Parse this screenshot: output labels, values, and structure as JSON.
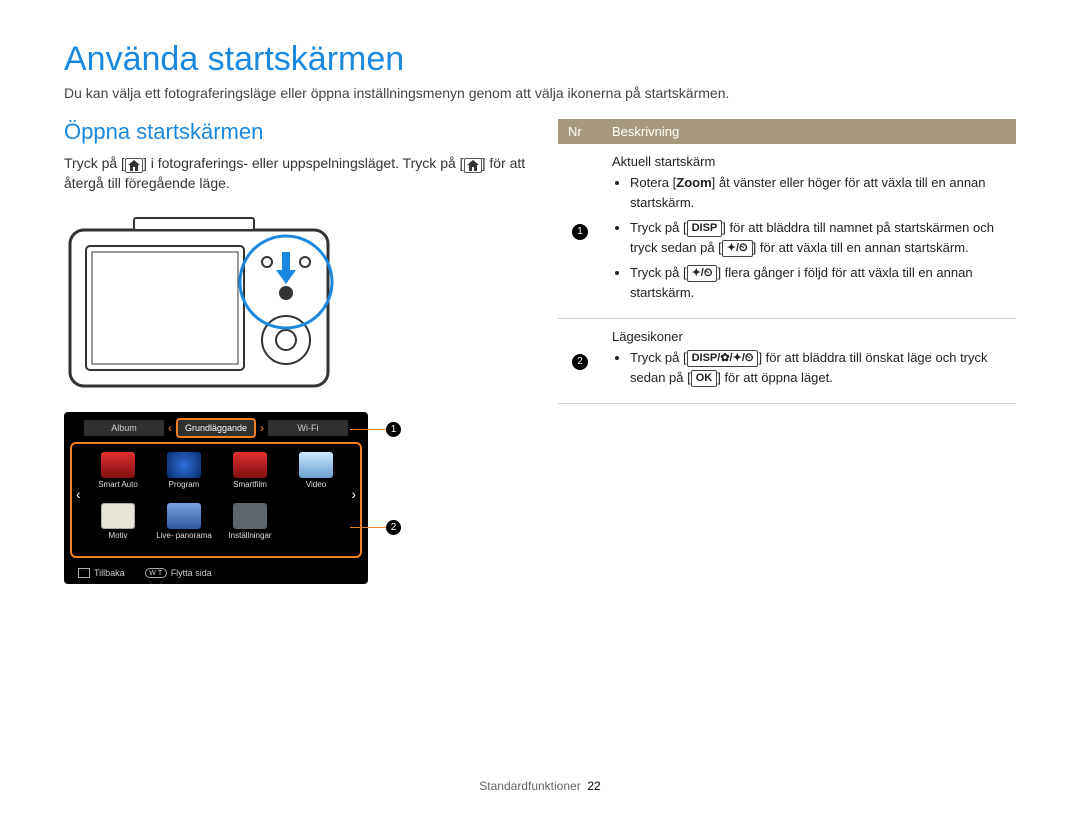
{
  "title": "Använda startskärmen",
  "intro": "Du kan välja ett fotograferingsläge eller öppna inställningsmenyn genom att välja ikonerna på startskärmen.",
  "subtitle": "Öppna startskärmen",
  "para_before_home1": "Tryck på [",
  "para_mid": "] i fotograferings- eller uppspelningsläget. Tryck på [",
  "para_after_home2": "] för att återgå till föregående läge.",
  "tabs": {
    "left": "Album",
    "center": "Grundläggande",
    "right": "Wi-Fi"
  },
  "modes": [
    {
      "key": "smartauto",
      "label": "Smart Auto"
    },
    {
      "key": "program",
      "label": "Program"
    },
    {
      "key": "smartfilm",
      "label": "Smartfilm"
    },
    {
      "key": "video",
      "label": "Video"
    },
    {
      "key": "motiv",
      "label": "Motiv"
    },
    {
      "key": "livepan",
      "label": "Live-\npanorama"
    },
    {
      "key": "settings",
      "label": "Inställningar"
    }
  ],
  "footerbar": {
    "back": "Tillbaka",
    "move": "Flytta sida"
  },
  "table": {
    "head": {
      "nr": "Nr",
      "desc": "Beskrivning"
    },
    "row1": {
      "lead": "Aktuell startskärm",
      "b1_a": "Rotera [",
      "b1_zoom": "Zoom",
      "b1_b": "] åt vänster eller höger för att växla till en annan startskärm.",
      "b2_a": "Tryck på [",
      "b2_disp": "DISP",
      "b2_b": "] för att bläddra till namnet på startskärmen och tryck sedan på [",
      "b2_c": "] för att växla till en annan startskärm.",
      "b3_a": "Tryck på [",
      "b3_b": "] flera gånger i följd för att växla till en annan startskärm."
    },
    "row2": {
      "lead": "Lägesikoner",
      "b1_a": "Tryck på [",
      "b1_disp": "DISP",
      "b1_b": "] för att bläddra till önskat läge och tryck sedan på [",
      "b1_ok": "OK",
      "b1_c": "] för att öppna läget."
    }
  },
  "callouts": {
    "c1": "1",
    "c2": "2"
  },
  "footer": {
    "section": "Standardfunktioner",
    "page": "22"
  },
  "glyphs": {
    "flash_timer": "✦/⏲",
    "disp_all": "DISP/✿/✦/⏲"
  }
}
